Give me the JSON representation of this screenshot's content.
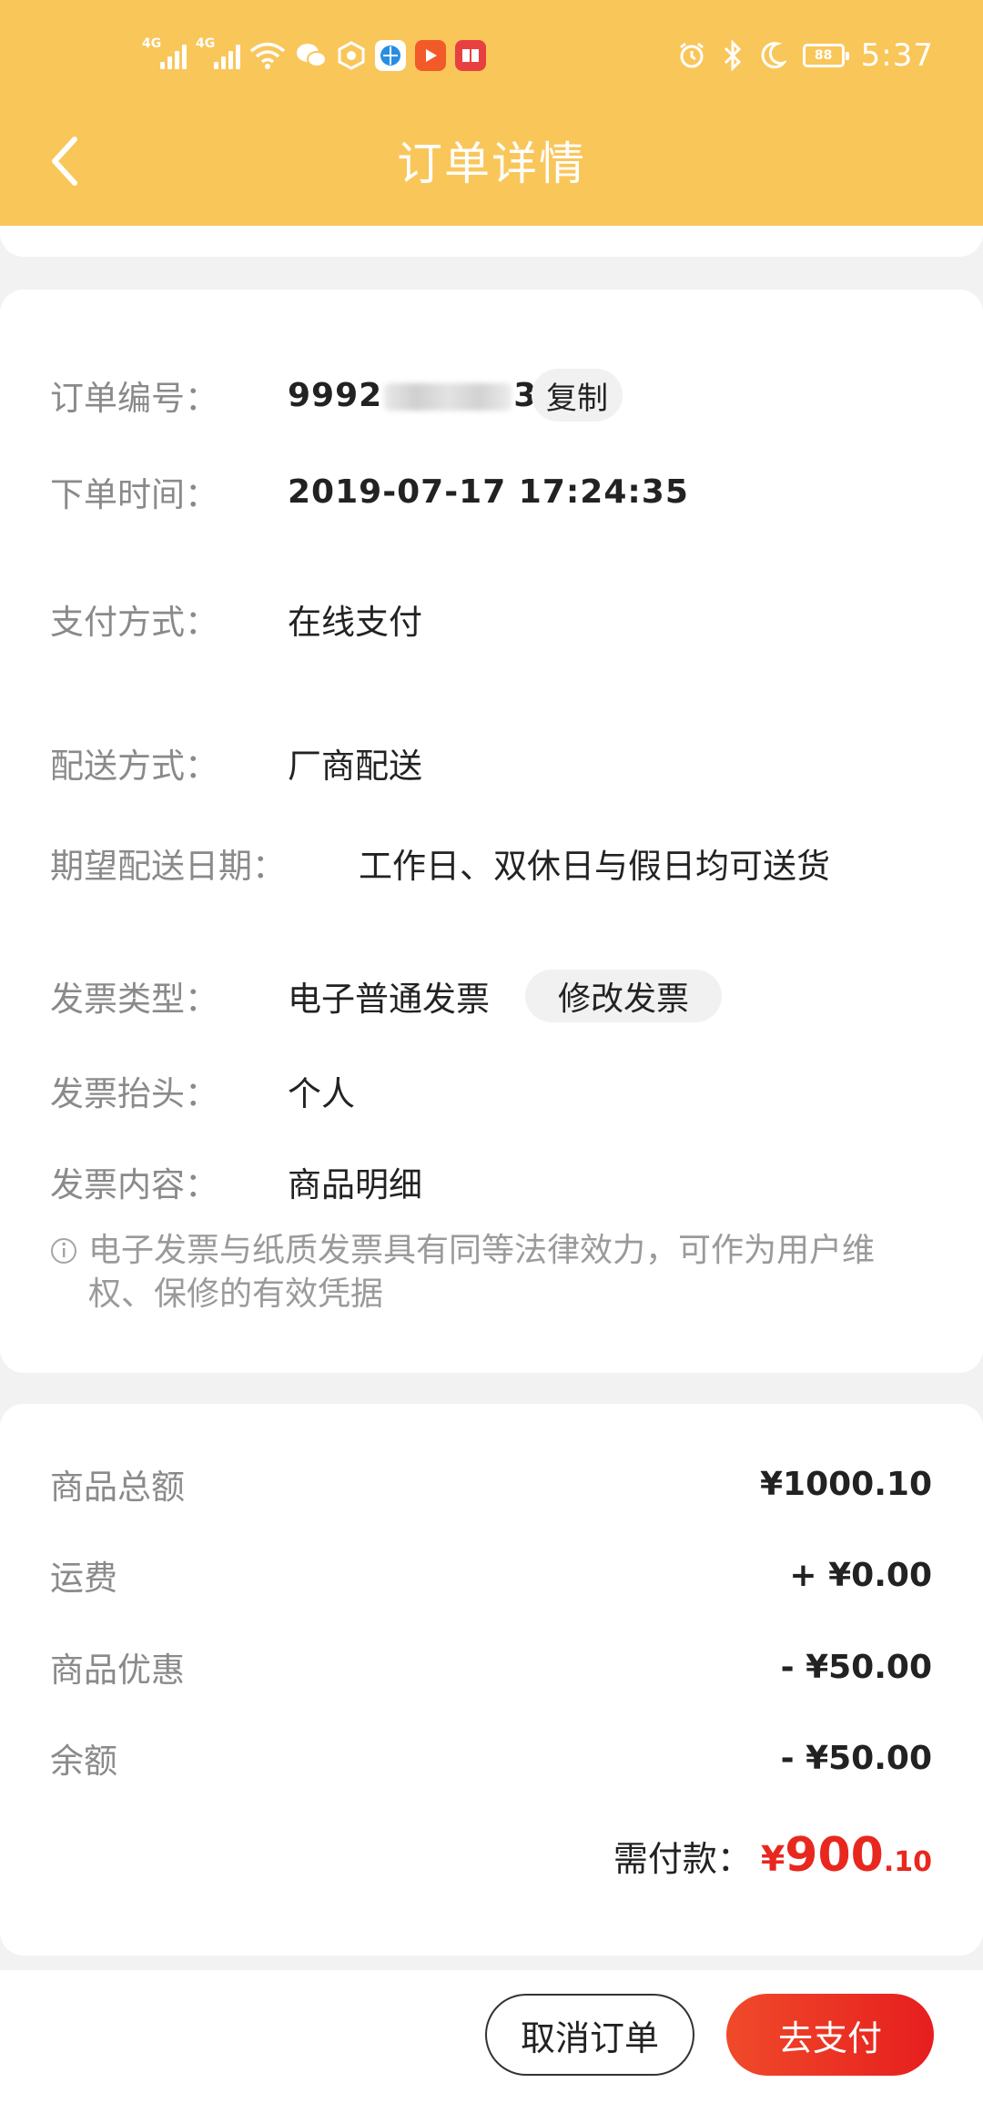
{
  "status_bar": {
    "signal_1": "4G",
    "signal_2": "4G",
    "battery": "88",
    "time": "5:37"
  },
  "header": {
    "title": "订单详情"
  },
  "order": {
    "number_label": "订单编号：",
    "number_prefix": "9992",
    "number_suffix": "39",
    "copy_label": "复制",
    "time_label": "下单时间：",
    "time_value": "2019-07-17 17:24:35",
    "payment_label": "支付方式：",
    "payment_value": "在线支付",
    "delivery_label": "配送方式：",
    "delivery_value": "厂商配送",
    "expected_label": "期望配送日期：",
    "expected_value": "工作日、双休日与假日均可送货",
    "invoice_type_label": "发票类型：",
    "invoice_type_value": "电子普通发票",
    "modify_invoice_label": "修改发票",
    "invoice_title_label": "发票抬头：",
    "invoice_title_value": "个人",
    "invoice_content_label": "发票内容：",
    "invoice_content_value": "商品明细",
    "note": "电子发票与纸质发票具有同等法律效力，可作为用户维权、保修的有效凭据"
  },
  "price": {
    "rows": [
      {
        "label": "商品总额",
        "value": "¥1000.10"
      },
      {
        "label": "运费",
        "value": "+ ¥0.00"
      },
      {
        "label": "商品优惠",
        "value": "- ¥50.00"
      },
      {
        "label": "余额",
        "value": "- ¥50.00"
      }
    ],
    "due_label": "需付款：",
    "due_currency": "¥",
    "due_integer": "900",
    "due_decimal": ".10"
  },
  "actions": {
    "cancel_label": "取消订单",
    "pay_label": "去支付"
  },
  "colors": {
    "header_bg": "#f9c65a",
    "accent_red": "#e8281f"
  }
}
